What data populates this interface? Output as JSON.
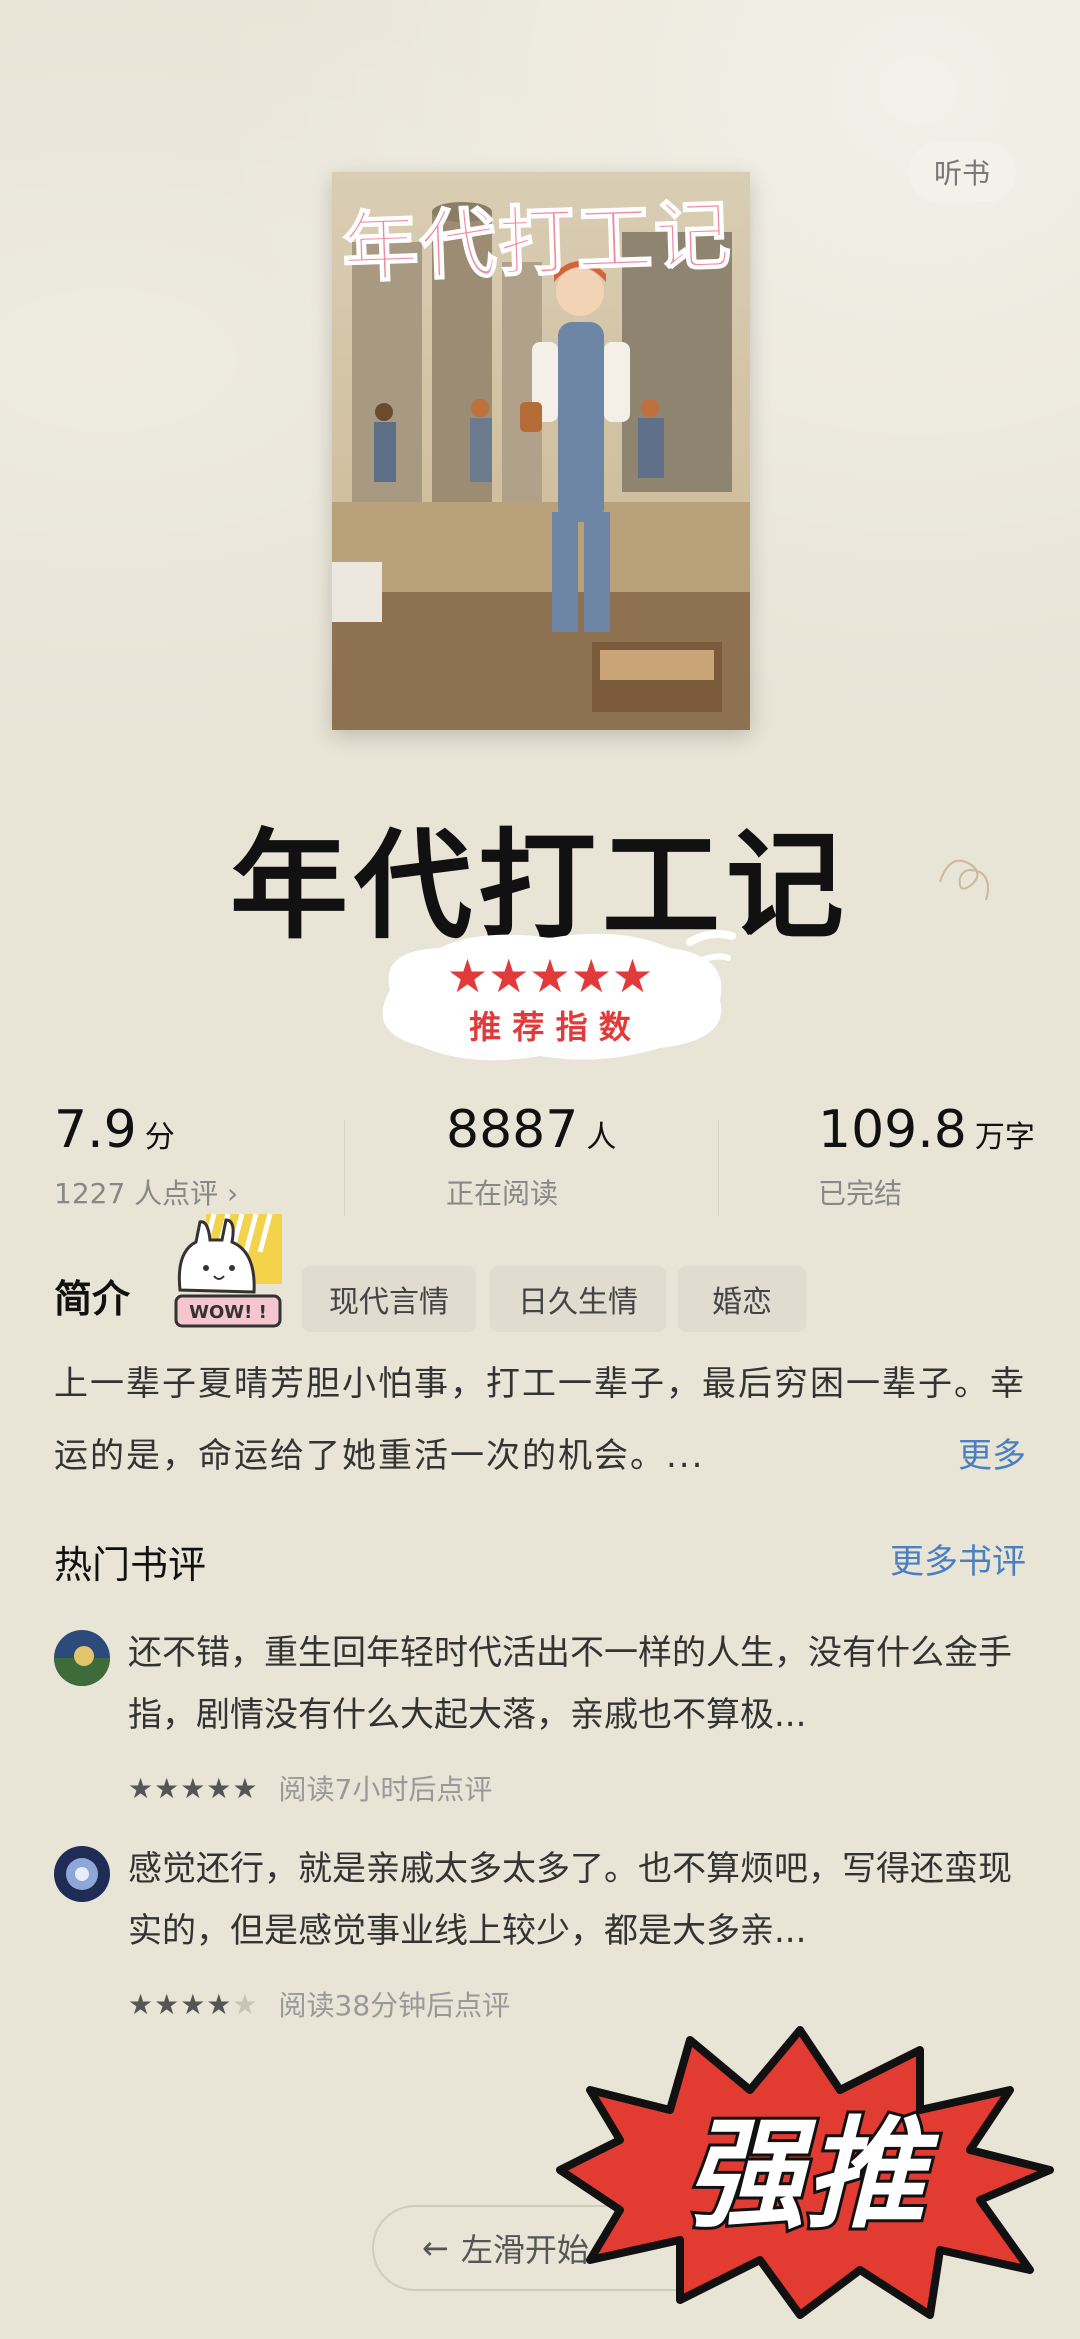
{
  "header": {
    "listen_label": "听书"
  },
  "cover": {
    "title": "年代打工记"
  },
  "book": {
    "title": "年代打工记"
  },
  "badge": {
    "stars": "★★★★★",
    "text": "推 荐 指 数"
  },
  "stats": {
    "score": {
      "value": "7.9",
      "unit": "分",
      "sub": "1227 人点评 ›"
    },
    "readers": {
      "value": "8887",
      "unit": "人",
      "sub": "正在阅读"
    },
    "words": {
      "value": "109.8",
      "unit": "万字",
      "sub": "已完结"
    }
  },
  "intro": {
    "label": "简介",
    "sticker_text": "WOW! !",
    "tags": [
      "现代言情",
      "日久生情",
      "婚恋"
    ],
    "text": "上一辈子夏晴芳胆小怕事，打工一辈子，最后穷困一辈子。幸运的是，命运给了她重活一次的机会。...",
    "more_label": "更多"
  },
  "reviews": {
    "title": "热门书评",
    "more_label": "更多书评",
    "items": [
      {
        "text": "还不错，重生回年轻时代活出不一样的人生，没有什么金手指，剧情没有什么大起大落，亲戚也不算极...",
        "rating": 5,
        "meta": "阅读7小时后点评"
      },
      {
        "text": "感觉还行，就是亲戚太多太多了。也不算烦吧，写得还蛮现实的，但是感觉事业线上较少，都是大多亲...",
        "rating": 4,
        "meta": "阅读38分钟后点评"
      }
    ]
  },
  "bottom": {
    "swipe_label": "左滑开始",
    "burst_text": "强推"
  },
  "colors": {
    "background": "#e8e4d6",
    "link": "#4a7fc0",
    "badge_red": "#e03a3a",
    "burst_red": "#e23b31"
  }
}
